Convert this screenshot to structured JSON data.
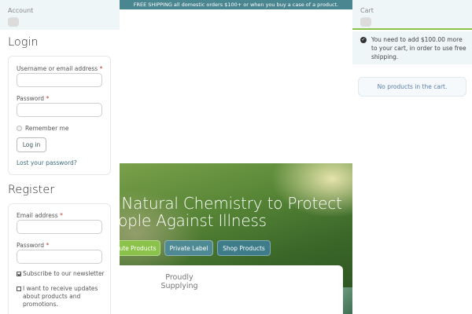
{
  "topbar": {
    "text": "FREE SHIPPING all domestic orders $100+ or when you buy a case of a product."
  },
  "hero": {
    "heading": "s Natural Chemistry to Protect eople Against Illness",
    "buttons": [
      "ute Products",
      "Private Label",
      "Shop Products"
    ],
    "supplying": "Proudly Supplying"
  },
  "account": {
    "title": "Account",
    "login": {
      "title": "Login",
      "username_label": "Username or email address",
      "password_label": "Password",
      "required_mark": "*",
      "remember_label": "Remember me",
      "login_button": "Log in",
      "lost_password": "Lost your password?"
    },
    "register": {
      "title": "Register",
      "email_label": "Email address",
      "password_label": "Password",
      "required_mark": "*",
      "newsletter_label": "Subscribe to our newsletter",
      "newsletter_checked": true,
      "updates_label": "I want to receive updates about products and promotions.",
      "updates_checked": false
    }
  },
  "cart": {
    "title": "Cart",
    "notice": "You need to add $100.00 more to your cart, in order to use free shipping.",
    "empty": "No products in the cart.",
    "accent_color": "#8bc34a"
  },
  "colors": {
    "topbar": "#4a8690",
    "primary_btn": "#8bc34a",
    "secondary_btn": "#4f8a94"
  }
}
